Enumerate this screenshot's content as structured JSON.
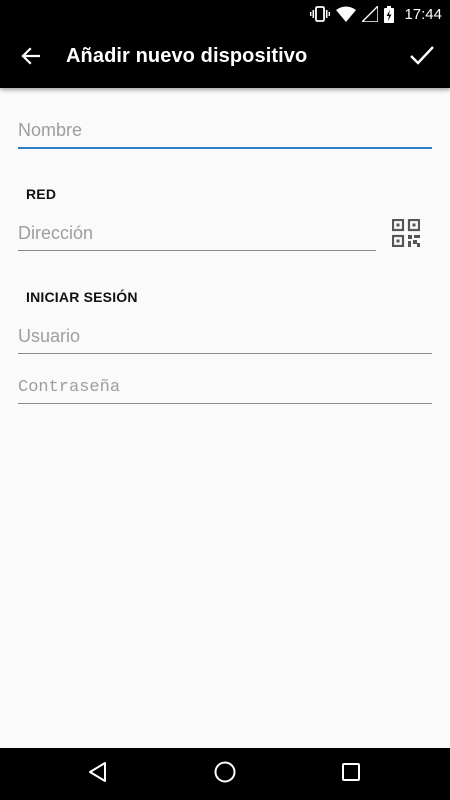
{
  "status_bar": {
    "time": "17:44",
    "icons": [
      "vibrate-icon",
      "wifi-icon",
      "signal-icon",
      "battery-charging-icon"
    ]
  },
  "app_bar": {
    "title": "Añadir nuevo dispositivo",
    "back_icon": "arrow-left-icon",
    "confirm_icon": "check-icon"
  },
  "form": {
    "name": {
      "placeholder": "Nombre",
      "value": ""
    },
    "network_section": "RED",
    "address": {
      "placeholder": "Dirección",
      "value": ""
    },
    "qr_icon": "qr-code-icon",
    "login_section": "INICIAR SESIÓN",
    "user": {
      "placeholder": "Usuario",
      "value": ""
    },
    "password": {
      "placeholder": "Contraseña",
      "value": ""
    }
  },
  "colors": {
    "accent": "#2d80c7",
    "app_bar": "#000000",
    "background": "#fafafa"
  },
  "nav_bar": {
    "icons": [
      "back-triangle-icon",
      "home-circle-icon",
      "recents-square-icon"
    ]
  }
}
